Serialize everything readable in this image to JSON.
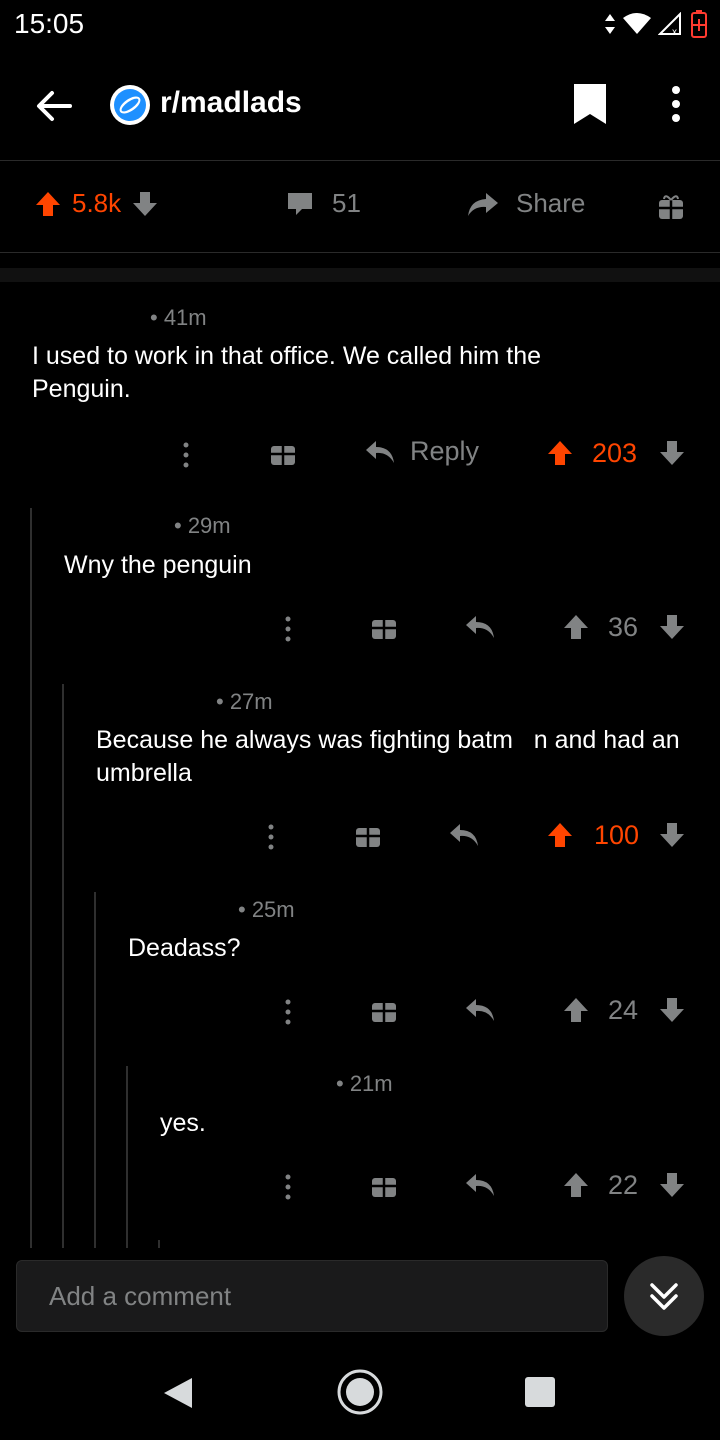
{
  "status_bar": {
    "time": "15:05"
  },
  "header": {
    "subreddit": "r/madlads"
  },
  "post_bar": {
    "upvotes": "5.8k",
    "comments": "51",
    "share_label": "Share"
  },
  "comments": [
    {
      "time": "• 41m",
      "body": "I used to work in that office. We called him the Penguin.",
      "score": "203",
      "reply_label": "Reply",
      "upvoted": true
    },
    {
      "time": "• 29m",
      "body": "Wny the penguin",
      "score": "36",
      "upvoted": false
    },
    {
      "time": "• 27m",
      "body": "Because he always was fighting batm   n and had an umbrella",
      "score": "100",
      "upvoted": true
    },
    {
      "time": "• 25m",
      "body": "Deadass?",
      "score": "24",
      "upvoted": false
    },
    {
      "time": "• 21m",
      "body": "yes.",
      "score": "22",
      "upvoted": false
    }
  ],
  "composer": {
    "placeholder": "Add a comment"
  },
  "colors": {
    "accent": "#ff4500",
    "muted": "#818384",
    "background": "#000000"
  }
}
